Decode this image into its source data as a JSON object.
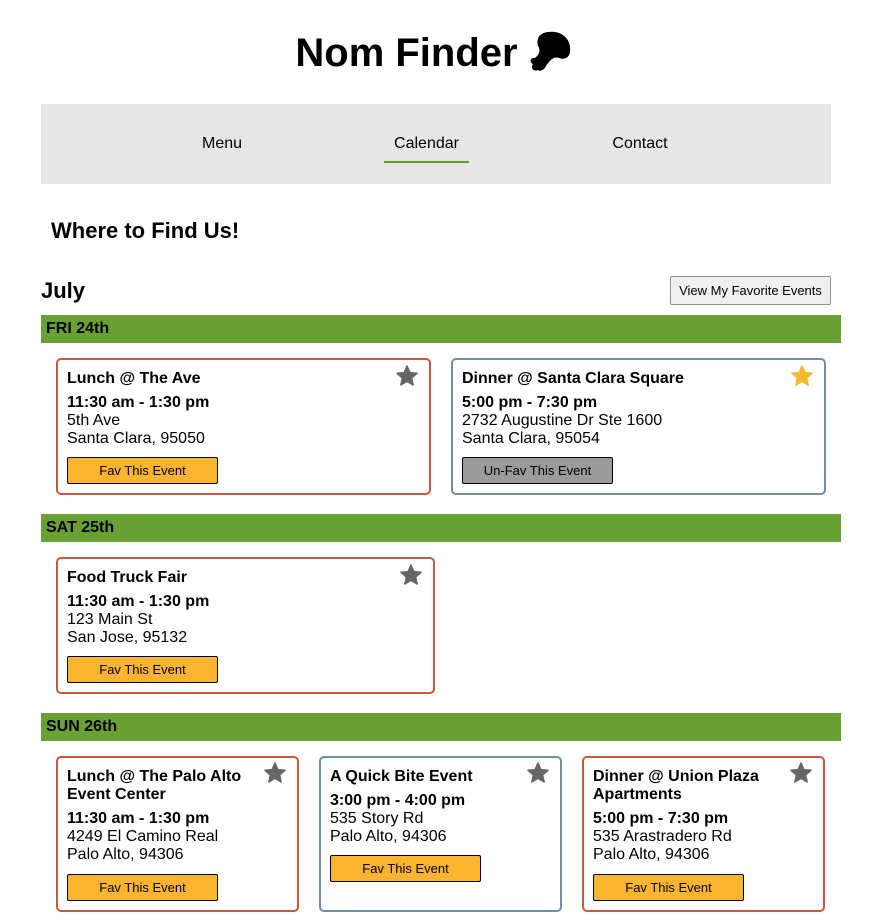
{
  "site": {
    "title": "Nom Finder",
    "logo_icon": "drumstick-icon"
  },
  "nav": {
    "items": [
      {
        "label": "Menu"
      },
      {
        "label": "Calendar",
        "active": true
      },
      {
        "label": "Contact"
      }
    ]
  },
  "page": {
    "heading": "Where to Find Us!",
    "month": "July",
    "view_favorites_label": "View My Favorite Events"
  },
  "colors": {
    "accent_green": "#69a135",
    "card_border_red": "#c9583c",
    "card_border_blue": "#6f8fa7",
    "fav_button": "#fbb42f",
    "unfav_button": "#9b9b9b",
    "star_active": "#f7b731",
    "star_inactive": "#666666"
  },
  "days": [
    {
      "label": "FRI 24th",
      "events": [
        {
          "title": "Lunch @ The Ave",
          "time": "11:30 am - 1:30 pm",
          "address": "5th Ave",
          "city": "Santa Clara, 95050",
          "favorited": false,
          "button_label": "Fav This Event"
        },
        {
          "title": "Dinner @ Santa Clara Square",
          "time": "5:00 pm - 7:30 pm",
          "address": "2732 Augustine Dr Ste 1600",
          "city": "Santa Clara, 95054",
          "favorited": true,
          "button_label": "Un-Fav This Event"
        }
      ]
    },
    {
      "label": "SAT 25th",
      "events": [
        {
          "title": "Food Truck Fair",
          "time": "11:30 am - 1:30 pm",
          "address": "123 Main St",
          "city": "San Jose, 95132",
          "favorited": false,
          "button_label": "Fav This Event"
        }
      ]
    },
    {
      "label": "SUN 26th",
      "events": [
        {
          "title_lines": [
            "Lunch @ The Palo Alto",
            "Event Center"
          ],
          "time": "11:30 am - 1:30 pm",
          "address": "4249 El Camino Real",
          "city": "Palo Alto, 94306",
          "favorited": false,
          "button_label": "Fav This Event"
        },
        {
          "title": "A Quick Bite Event",
          "time": "3:00 pm - 4:00 pm",
          "address": "535 Story Rd",
          "city": "Palo Alto, 94306",
          "favorited": false,
          "button_label": "Fav This Event"
        },
        {
          "title_lines": [
            "Dinner @ Union Plaza",
            "Apartments"
          ],
          "time": "5:00 pm - 7:30 pm",
          "address": "535 Arastradero Rd",
          "city": "Palo Alto, 94306",
          "favorited": false,
          "button_label": "Fav This Event"
        }
      ]
    }
  ]
}
